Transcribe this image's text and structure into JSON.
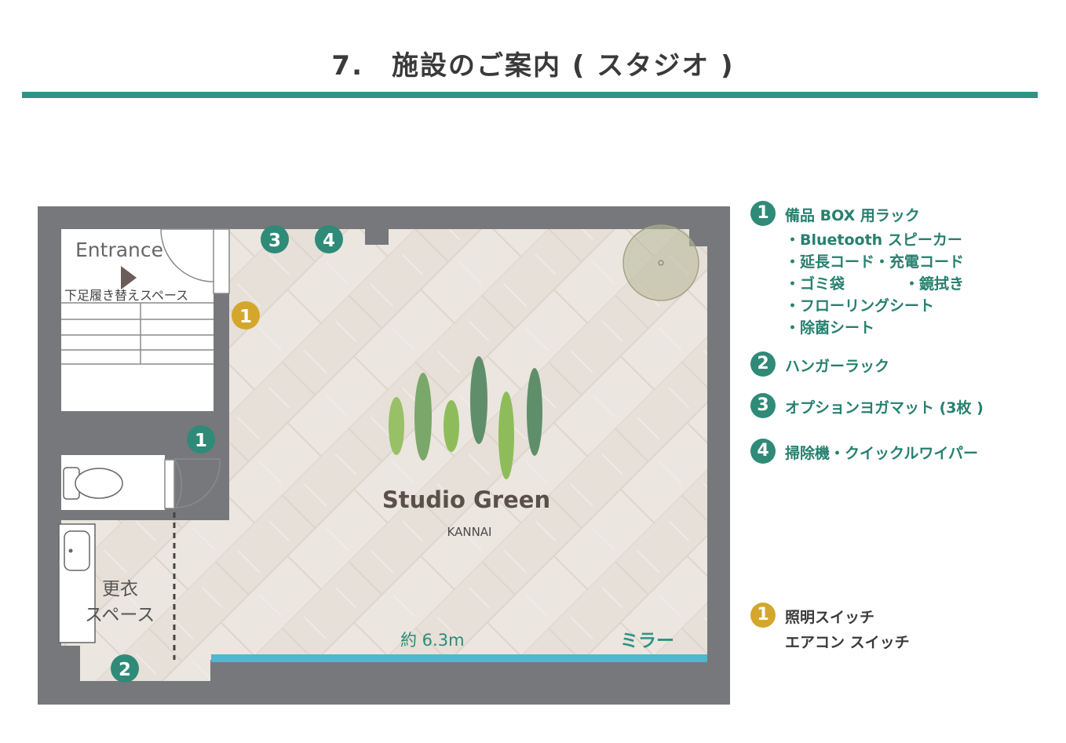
{
  "title": "7.　施設のご案内 ( スタジオ )",
  "colors": {
    "accent_teal": "#2f9484",
    "wall_gray": "#77787c",
    "floor_light": "#e9e3dc",
    "mirror_blue": "#4db8cf",
    "badge_green": "#2f8a78",
    "badge_gold": "#d4a72c",
    "logo_text": "#5a4f49"
  },
  "floor_plan": {
    "entrance_label": "Entrance",
    "shoe_space_label": "下足履き替えスペース",
    "changing_label_1": "更衣",
    "changing_label_2": "スペース",
    "width_label": "約 6.3m",
    "mirror_label": "ミラー",
    "logo_main": "Studio Green",
    "logo_sub": "KANNAI",
    "markers": {
      "m3": "3",
      "m4": "4",
      "m1_gold": "1",
      "m1_green": "1",
      "m2": "2"
    }
  },
  "legend": {
    "item1": {
      "num": "1",
      "heading": "備品 BOX 用ラック",
      "details": [
        "・Bluetooth スピーカー",
        "・延長コード・充電コード",
        "・ゴミ袋",
        "・鏡拭き",
        "・フローリングシート",
        "・除菌シート"
      ]
    },
    "item2": {
      "num": "2",
      "heading": "ハンガーラック"
    },
    "item3": {
      "num": "3",
      "heading": "オプションヨガマット (3枚 )"
    },
    "item4": {
      "num": "4",
      "heading": "掃除機・クイックルワイパー"
    },
    "item_switch": {
      "num": "1",
      "heading": "照明スイッチ",
      "line2": "エアコン スイッチ"
    }
  }
}
